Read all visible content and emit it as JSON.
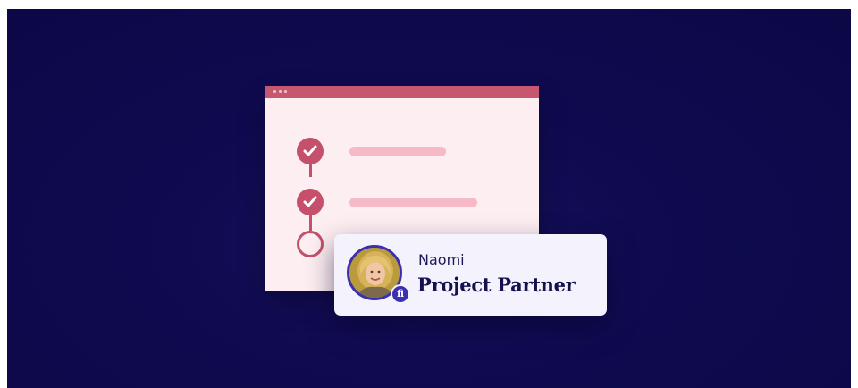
{
  "card": {
    "name": "Naomi",
    "role": "Project Partner",
    "badge_text": "fi"
  },
  "checklist": {
    "steps": [
      {
        "status": "completed",
        "icon": "check-icon"
      },
      {
        "status": "completed",
        "icon": "check-icon"
      },
      {
        "status": "pending",
        "icon": "empty-circle-icon"
      }
    ]
  },
  "colors": {
    "background": "#0f0a4f",
    "window_bar": "#c7566f",
    "window_body": "#fdeef1",
    "step_accent": "#c4506b",
    "pill": "#f6b9c8",
    "card_background": "#f3f2fd",
    "badge": "#3b2fb4"
  }
}
